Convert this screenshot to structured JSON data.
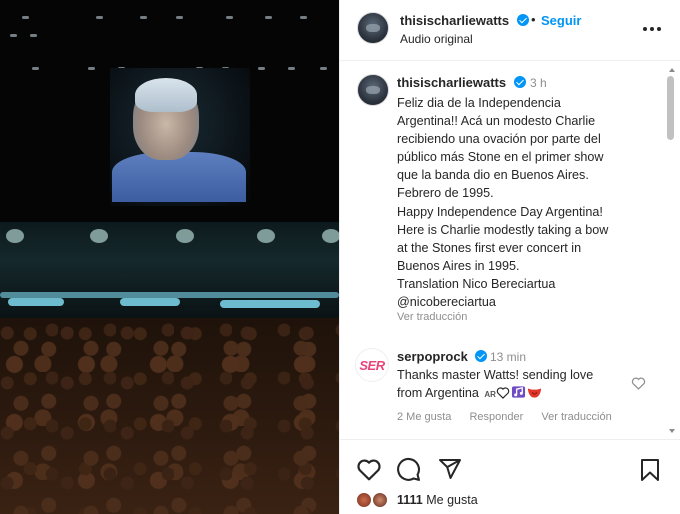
{
  "post": {
    "author": "thisischarliewatts",
    "follow_label": "Seguir",
    "bullet": "•",
    "audio_label": "Audio original"
  },
  "caption": {
    "author": "thisischarliewatts",
    "time": "3 h",
    "lines": [
      "Feliz dia de la Independencia",
      "Argentina!! Acá un modesto Charlie",
      "recibiendo una ovación por parte del",
      "público más Stone en el primer show",
      "que la banda dio en Buenos Aires.",
      "Febrero de 1995.",
      "Happy Independence Day Argentina!",
      "Here is Charlie modestly taking a bow",
      "at the Stones first ever concert in",
      "Buenos Aires in 1995.",
      "Translation Nico Bereciartua",
      "@nicobereciartua"
    ],
    "translate_label": "Ver traducción"
  },
  "comment": {
    "avatar_text": "SER",
    "author": "serpoprock",
    "time": "13 min",
    "line1": "Thanks master Watts! sending love",
    "line2": "from Argentina",
    "flag_text": "AR",
    "likes": "2 Me gusta",
    "reply_label": "Responder",
    "translate_label": "Ver traducción"
  },
  "likes": {
    "count": "1111",
    "label": "Me gusta"
  },
  "icons": {
    "like": "heart-icon",
    "comment": "comment-bubble-icon",
    "share": "paper-plane-icon",
    "save": "bookmark-icon",
    "more": "more-horizontal-icon"
  },
  "colors": {
    "link_blue": "#0095f6",
    "text": "#262626",
    "muted": "#8e8e8e",
    "brand_pink": "#e8467a"
  }
}
